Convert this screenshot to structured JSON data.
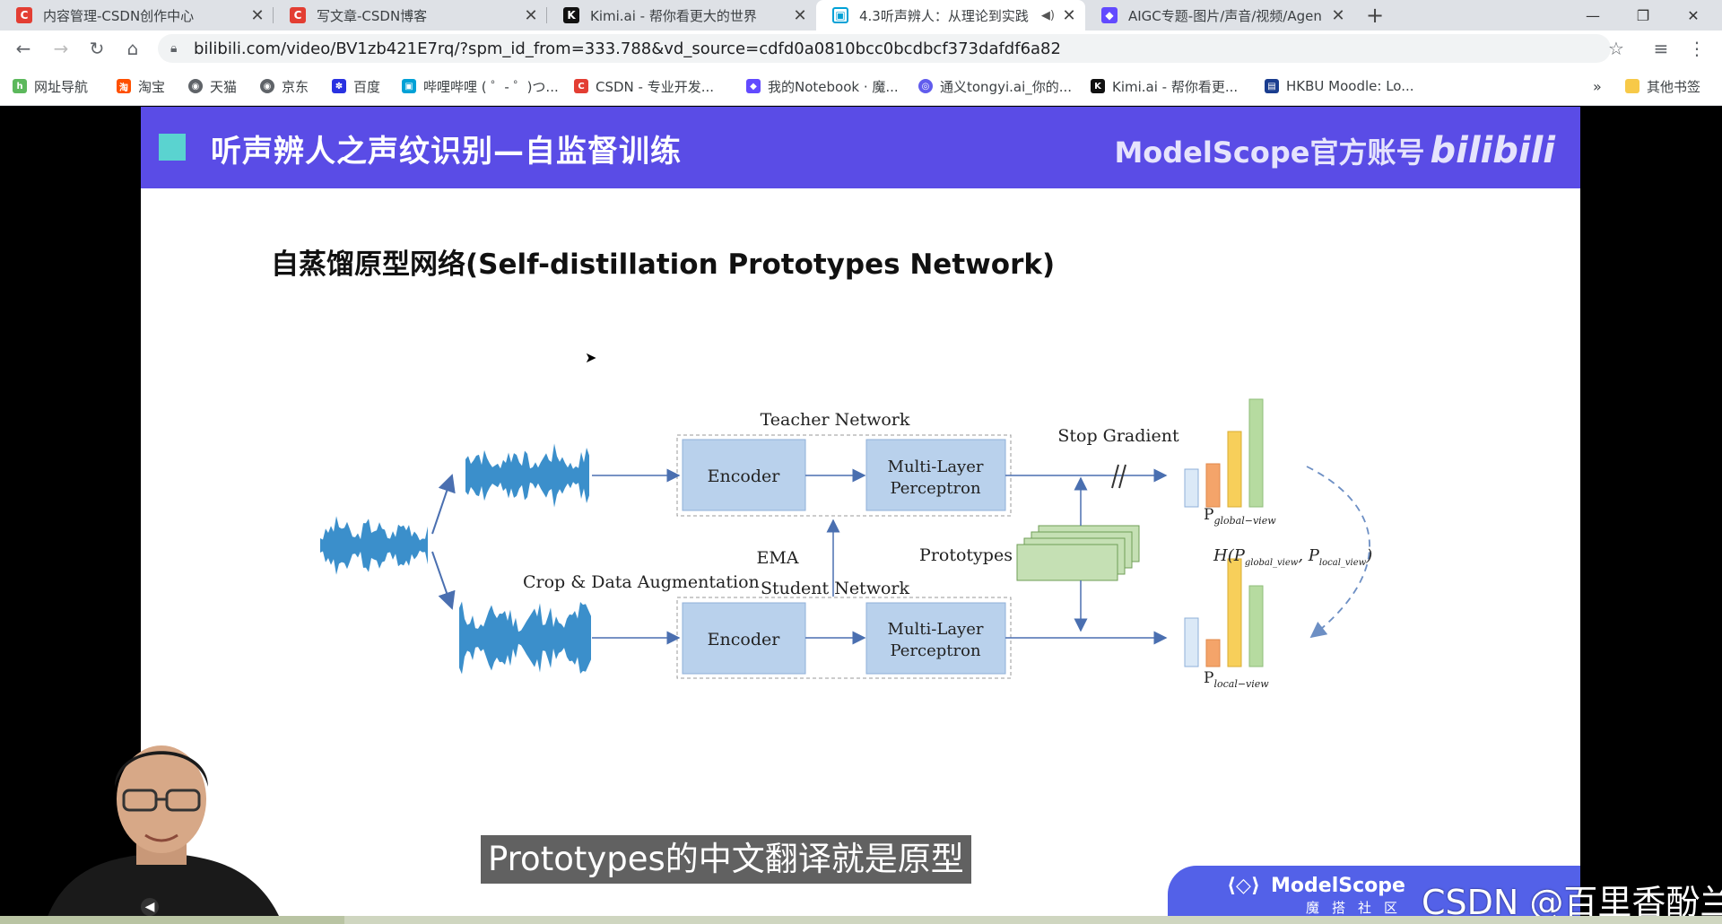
{
  "browser": {
    "tabs": [
      {
        "title": "内容管理-CSDN创作中心",
        "icon": "csdn-icon"
      },
      {
        "title": "写文章-CSDN博客",
        "icon": "csdn-icon"
      },
      {
        "title": "Kimi.ai - 帮你看更大的世界",
        "icon": "kimi-icon"
      },
      {
        "title": "4.3听声辨人：从理论到实践",
        "icon": "bilibili-icon",
        "active": true,
        "audio": true
      },
      {
        "title": "AIGC专题-图片/声音/视频/Agen",
        "icon": "aigc-icon"
      }
    ],
    "url": "bilibili.com/video/BV1zb421E7rq/?spm_id_from=333.788&vd_source=cdfd0a0810bcc0bcdbcf373dafdf6a82",
    "bookmarks": [
      {
        "label": "网址导航",
        "color": "#5cb85c"
      },
      {
        "label": "淘宝",
        "color": "#ff5000"
      },
      {
        "label": "天猫",
        "color": "#5f6368"
      },
      {
        "label": "京东",
        "color": "#5f6368"
      },
      {
        "label": "百度",
        "color": "#2932e1"
      },
      {
        "label": "哔哩哔哩 ( ゜- ゜)つ...",
        "color": "#00a1d6"
      },
      {
        "label": "CSDN - 专业开发...",
        "color": "#e33e33"
      },
      {
        "label": "我的Notebook · 魔...",
        "color": "#624aff"
      },
      {
        "label": "通义tongyi.ai_你的...",
        "color": "#615ced"
      },
      {
        "label": "Kimi.ai - 帮你看更...",
        "color": "#111111"
      },
      {
        "label": "HKBU Moodle: Lo...",
        "color": "#1a3d8f"
      }
    ],
    "more_label": "»",
    "other_bookmarks": "其他书签"
  },
  "slide": {
    "title": "听声辨人之声纹识别—自监督训练",
    "brand": "ModelScope官方账号",
    "bili_logo": "bilibili",
    "diagram_title": "自蒸馏原型网络(Self-distillation Prototypes Network)"
  },
  "diagram": {
    "teacher_network": "Teacher Network",
    "student_network": "Student Network",
    "encoder": "Encoder",
    "mlp_line1": "Multi-Layer",
    "mlp_line2": "Perceptron",
    "stop_gradient": "Stop Gradient",
    "ema": "EMA",
    "prototypes": "Prototypes",
    "crop_aug": "Crop & Data Augmentation",
    "p_global": "P",
    "p_global_sub": "global−view",
    "p_local": "P",
    "p_local_sub": "local−view",
    "loss_formula": "H(P",
    "loss_sub1": "global_view",
    "loss_mid": ", P",
    "loss_sub2": "local_view",
    "loss_end": ")",
    "global_bars": [
      0.35,
      0.4,
      0.7,
      1.0
    ],
    "local_bars": [
      0.45,
      0.25,
      1.0,
      0.75
    ]
  },
  "video": {
    "subtitle": "Prototypes的中文翻译就是原型",
    "ms_logo": "ModelScope",
    "ms_sub": "魔搭社区",
    "watermark": "CSDN @百里香酚兰",
    "progress": 0.2
  }
}
